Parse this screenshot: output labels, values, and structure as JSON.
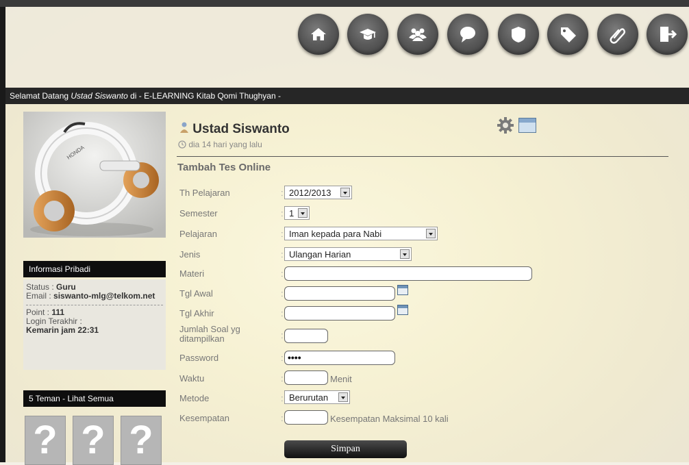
{
  "welcome": {
    "prefix": "Selamat Datang ",
    "user": "Ustad Siswanto",
    "suffix": " di - E-LEARNING Kitab Qomi Thughyan -"
  },
  "nav": [
    "home-icon",
    "graduation-icon",
    "group-icon",
    "chat-icon",
    "shield-icon",
    "tag-icon",
    "paperclip-icon",
    "logout-icon"
  ],
  "profile": {
    "name": "Ustad Siswanto",
    "time": "dia 14 hari yang lalu"
  },
  "photo_brand": "HONDA",
  "section_title": "Tambah Tes Online",
  "info": {
    "header": "Informasi Pribadi",
    "status_label": "Status : ",
    "status": "Guru",
    "email_label": "Email : ",
    "email": "siswanto-mlg@telkom.net",
    "point_label": "Point : ",
    "point": "111",
    "login_label": "Login Terakhir :",
    "login": "Kemarin jam 22:31"
  },
  "friends": {
    "header": "5 Teman - Lihat Semua",
    "placeholder": "?"
  },
  "form": {
    "th_label": "Th Pelajaran",
    "th_value": "2012/2013",
    "semester_label": "Semester",
    "semester_value": "1",
    "pelajaran_label": "Pelajaran",
    "pelajaran_value": "Iman kepada para Nabi",
    "jenis_label": "Jenis",
    "jenis_value": "Ulangan Harian",
    "materi_label": "Materi",
    "materi_value": "",
    "tgl_awal_label": "Tgl Awal",
    "tgl_awal_value": "",
    "tgl_akhir_label": "Tgl Akhir",
    "tgl_akhir_value": "",
    "jumlah_label": "Jumlah Soal yg ditampilkan",
    "jumlah_value": "",
    "password_label": "Password",
    "password_value": "••••",
    "waktu_label": "Waktu",
    "waktu_value": "",
    "waktu_suffix": "Menit",
    "metode_label": "Metode",
    "metode_value": "Berurutan",
    "kesempatan_label": "Kesempatan",
    "kesempatan_value": "",
    "kesempatan_suffix": "Kesempatan Maksimal 10 kali",
    "colon": ":",
    "submit": "Simpan"
  }
}
